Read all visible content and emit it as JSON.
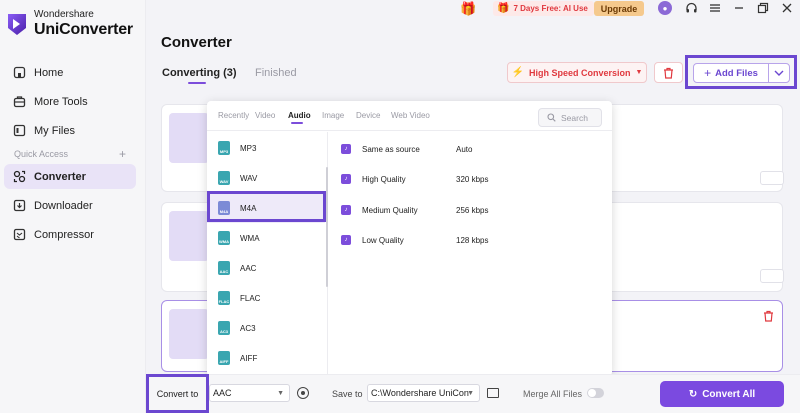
{
  "app": {
    "brand": "Wondershare",
    "name": "UniConverter"
  },
  "sidebar": {
    "items": [
      {
        "label": "Home",
        "icon": "home-icon"
      },
      {
        "label": "More Tools",
        "icon": "toolbox-icon"
      },
      {
        "label": "My Files",
        "icon": "files-icon"
      }
    ],
    "quick_access_label": "Quick Access",
    "quick_items": [
      {
        "label": "Converter",
        "icon": "converter-icon",
        "active": true
      },
      {
        "label": "Downloader",
        "icon": "download-icon"
      },
      {
        "label": "Compressor",
        "icon": "compress-icon"
      }
    ]
  },
  "titlebar": {
    "promo": "7 Days Free: AI Use",
    "upgrade": "Upgrade"
  },
  "main": {
    "title": "Converter",
    "tabs": [
      {
        "label": "Converting (3)",
        "active": true
      },
      {
        "label": "Finished",
        "active": false
      }
    ],
    "high_speed_label": "High Speed Conversion",
    "add_files_label": "Add Files"
  },
  "format_panel": {
    "tabs": [
      "Recently",
      "Video",
      "Audio",
      "Image",
      "Device",
      "Web Video"
    ],
    "active_tab": "Audio",
    "search_placeholder": "Search",
    "formats": [
      {
        "name": "MP3",
        "color": "#3aa6b0"
      },
      {
        "name": "WAV",
        "color": "#3aa6b0"
      },
      {
        "name": "M4A",
        "color": "#7c8bd6",
        "selected": true
      },
      {
        "name": "WMA",
        "color": "#3aa6b0"
      },
      {
        "name": "AAC",
        "color": "#3aa6b0"
      },
      {
        "name": "FLAC",
        "color": "#3aa6b0"
      },
      {
        "name": "AC3",
        "color": "#3aa6b0"
      },
      {
        "name": "AIFF",
        "color": "#3aa6b0"
      }
    ],
    "qualities": [
      {
        "name": "Same as source",
        "value": "Auto"
      },
      {
        "name": "High Quality",
        "value": "320 kbps"
      },
      {
        "name": "Medium Quality",
        "value": "256 kbps"
      },
      {
        "name": "Low Quality",
        "value": "128 kbps"
      }
    ]
  },
  "bottom": {
    "convert_to_label": "Convert to",
    "convert_to_value": "AAC",
    "save_to_label": "Save to",
    "save_to_value": "C:\\Wondershare UniCon",
    "merge_label": "Merge All Files",
    "convert_all_label": "Convert All"
  },
  "colors": {
    "accent": "#7b4ae0",
    "highlight_box": "#6b47d0",
    "promo_red": "#e0393f"
  }
}
